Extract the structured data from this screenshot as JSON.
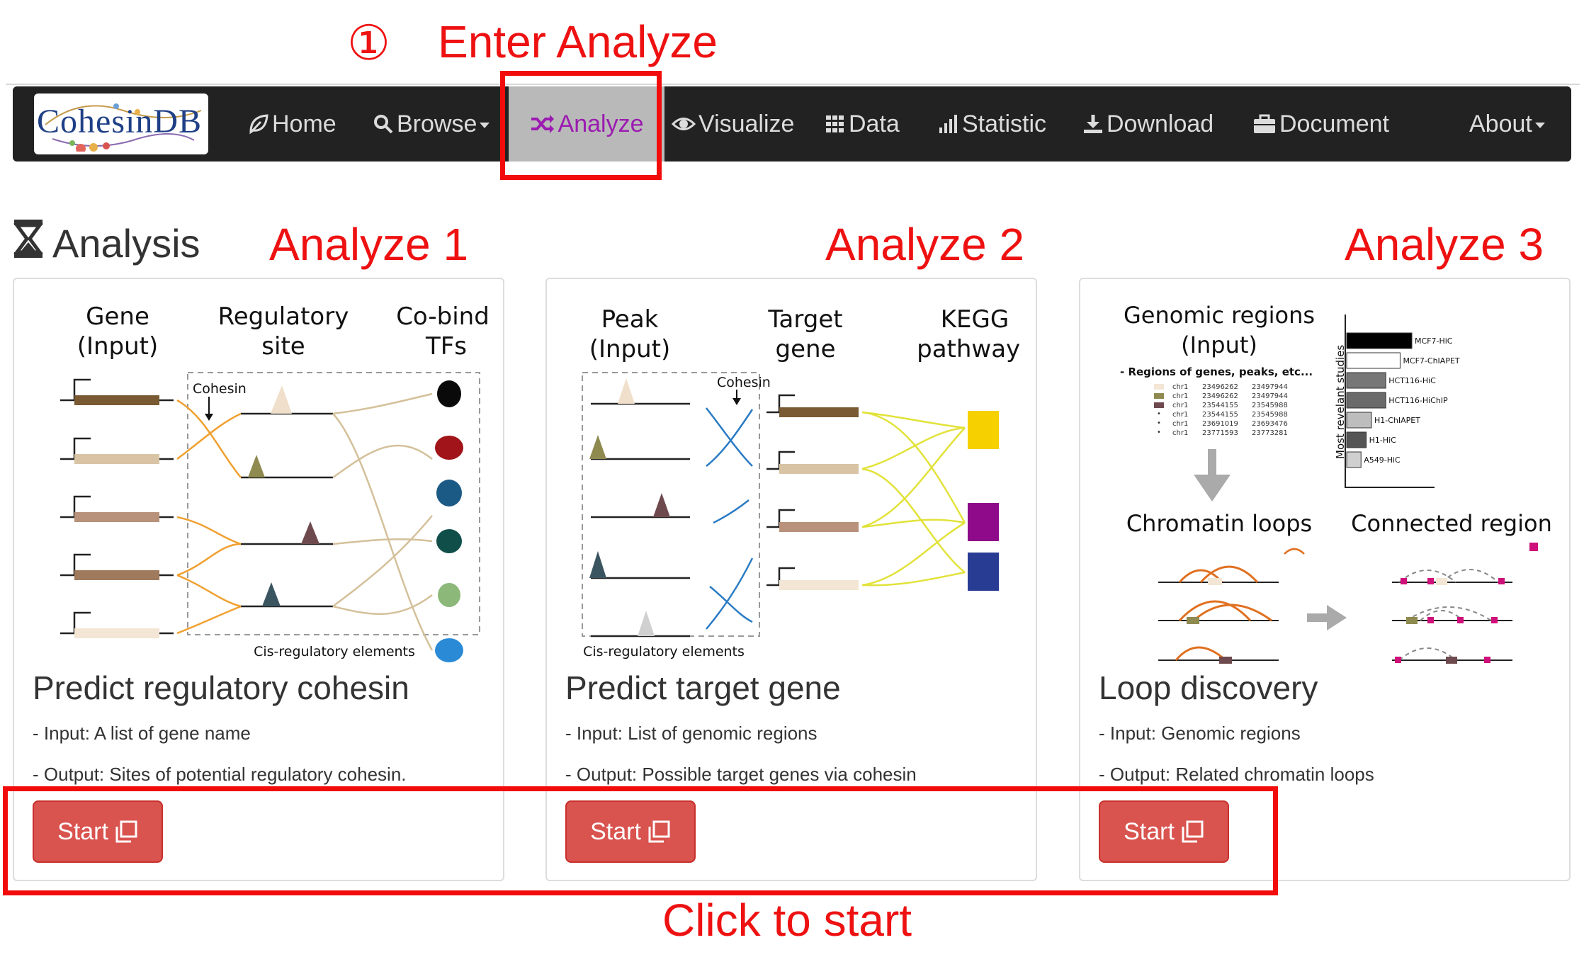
{
  "annotations": {
    "step_marker": "①",
    "enter_analyze": "Enter Analyze",
    "analyze_1": "Analyze 1",
    "analyze_2": "Analyze 2",
    "analyze_3": "Analyze 3",
    "click_to_start": "Click to start"
  },
  "navbar": {
    "logo_text": "CohesinDB",
    "items": [
      {
        "label": "Home",
        "icon": "leaf-icon"
      },
      {
        "label": "Browse",
        "icon": "search-icon",
        "dropdown": true
      },
      {
        "label": "Analyze",
        "icon": "shuffle-icon",
        "active": true
      },
      {
        "label": "Visualize",
        "icon": "eye-icon"
      },
      {
        "label": "Data",
        "icon": "grid-icon"
      },
      {
        "label": "Statistic",
        "icon": "bar-chart-icon"
      },
      {
        "label": "Download",
        "icon": "download-icon"
      },
      {
        "label": "Document",
        "icon": "briefcase-icon"
      },
      {
        "label": "About",
        "dropdown": true
      }
    ],
    "active_color": "#9b1bb0"
  },
  "page": {
    "heading": "Analysis",
    "heading_icon": "hourglass-icon"
  },
  "cards": [
    {
      "title": "Predict regulatory cohesin",
      "input": "- Input: A list of gene name",
      "output": "- Output: Sites of potential regulatory cohesin.",
      "button": "Start",
      "figure": {
        "col1": [
          "Gene",
          "(Input)"
        ],
        "col2": [
          "Regulatory",
          "site"
        ],
        "col3": [
          "Co-bind",
          "TFs"
        ],
        "cohesin_label": "Cohesin",
        "footer": "Cis-regulatory elements"
      }
    },
    {
      "title": "Predict target gene",
      "input": "- Input: List of genomic regions",
      "output": "- Output: Possible target genes via cohesin",
      "button": "Start",
      "figure": {
        "col1": [
          "Peak",
          "(Input)"
        ],
        "col2": [
          "Target",
          "gene"
        ],
        "col3": [
          "KEGG",
          "pathways"
        ],
        "cohesin_label": "Cohesin",
        "footer": "Cis-regulatory elements"
      }
    },
    {
      "title": "Loop discovery",
      "input": "- Input: Genomic regions",
      "output": "- Output: Related chromatin loops",
      "button": "Start",
      "figure": {
        "top_title": [
          "Genomic regions",
          "(Input)"
        ],
        "regions_note": "- Regions of genes, peaks, etc...",
        "region_rows": [
          [
            "chr1",
            "23496262",
            "23497944"
          ],
          [
            "chr1",
            "23496262",
            "23497944"
          ],
          [
            "chr1",
            "23544155",
            "23545988"
          ],
          [
            "chr1",
            "23544155",
            "23545988"
          ],
          [
            "chr1",
            "23691019",
            "23693476"
          ],
          [
            "chr1",
            "23771593",
            "23773281"
          ]
        ],
        "chart_ylabel": "Most revelant studies",
        "chart_bars": [
          {
            "label": "MCF7-HiC",
            "value": 1.0
          },
          {
            "label": "MCF7-ChIAPET",
            "value": 0.82
          },
          {
            "label": "HCT116-HiC",
            "value": 0.6
          },
          {
            "label": "HCT116-HiChIP",
            "value": 0.6
          },
          {
            "label": "H1-ChIAPET",
            "value": 0.38
          },
          {
            "label": "H1-HiC",
            "value": 0.3
          },
          {
            "label": "A549-HiC",
            "value": 0.22
          }
        ],
        "loops_label": "Chromatin loops",
        "connected_label": "Connected region"
      }
    }
  ]
}
